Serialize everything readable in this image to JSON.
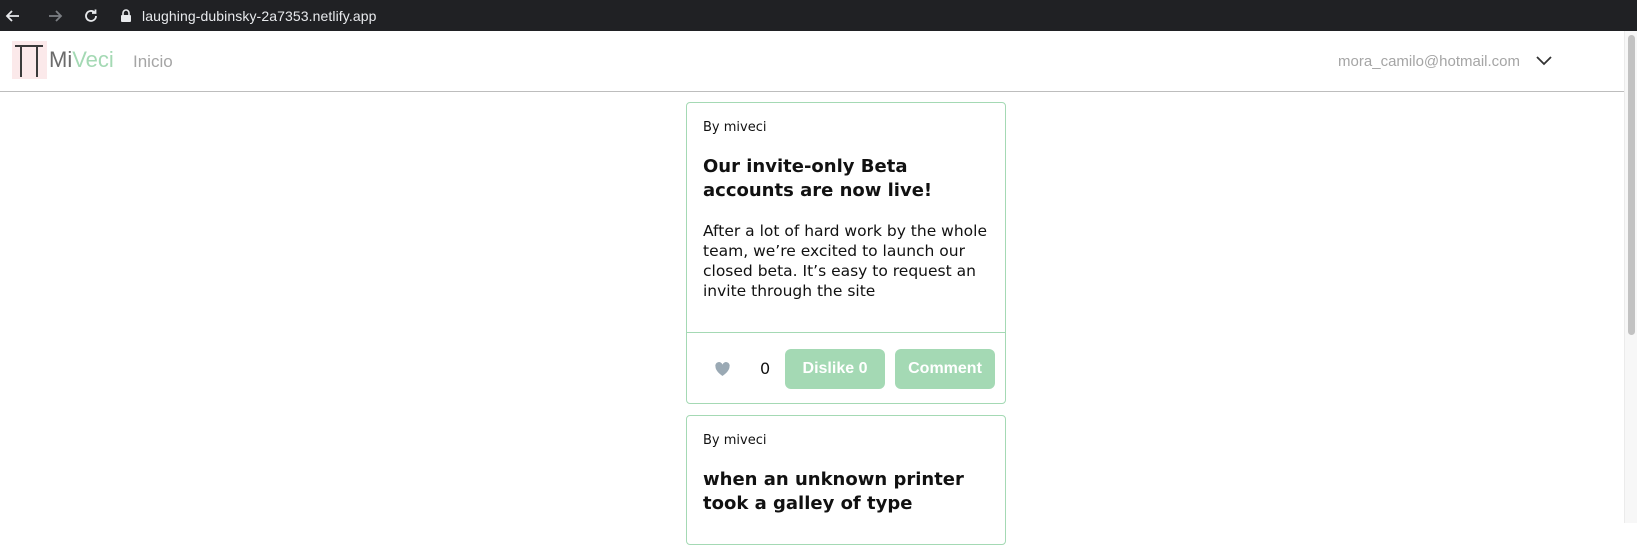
{
  "browser": {
    "url": "laughing-dubinsky-2a7353.netlify.app"
  },
  "header": {
    "logo_mi": "Mi",
    "logo_veci": "Veci",
    "nav_home": "Inicio",
    "user_email": "mora_camilo@hotmail.com"
  },
  "posts": [
    {
      "author": "By miveci",
      "title": "Our invite-only Beta accounts are now live!",
      "body": "After a lot of hard work by the whole team, we’re excited to launch our closed beta. It’s easy to request an invite through the site",
      "likes": "0",
      "dislike_label": "Dislike 0",
      "comment_label": "Comment"
    },
    {
      "author": "By miveci",
      "title": "when an unknown printer took a galley of type"
    }
  ],
  "colors": {
    "accent": "#a4d9b4",
    "chrome_bg": "#202124",
    "muted_text": "#a5a5a5",
    "heart": "#9aa9b4"
  }
}
